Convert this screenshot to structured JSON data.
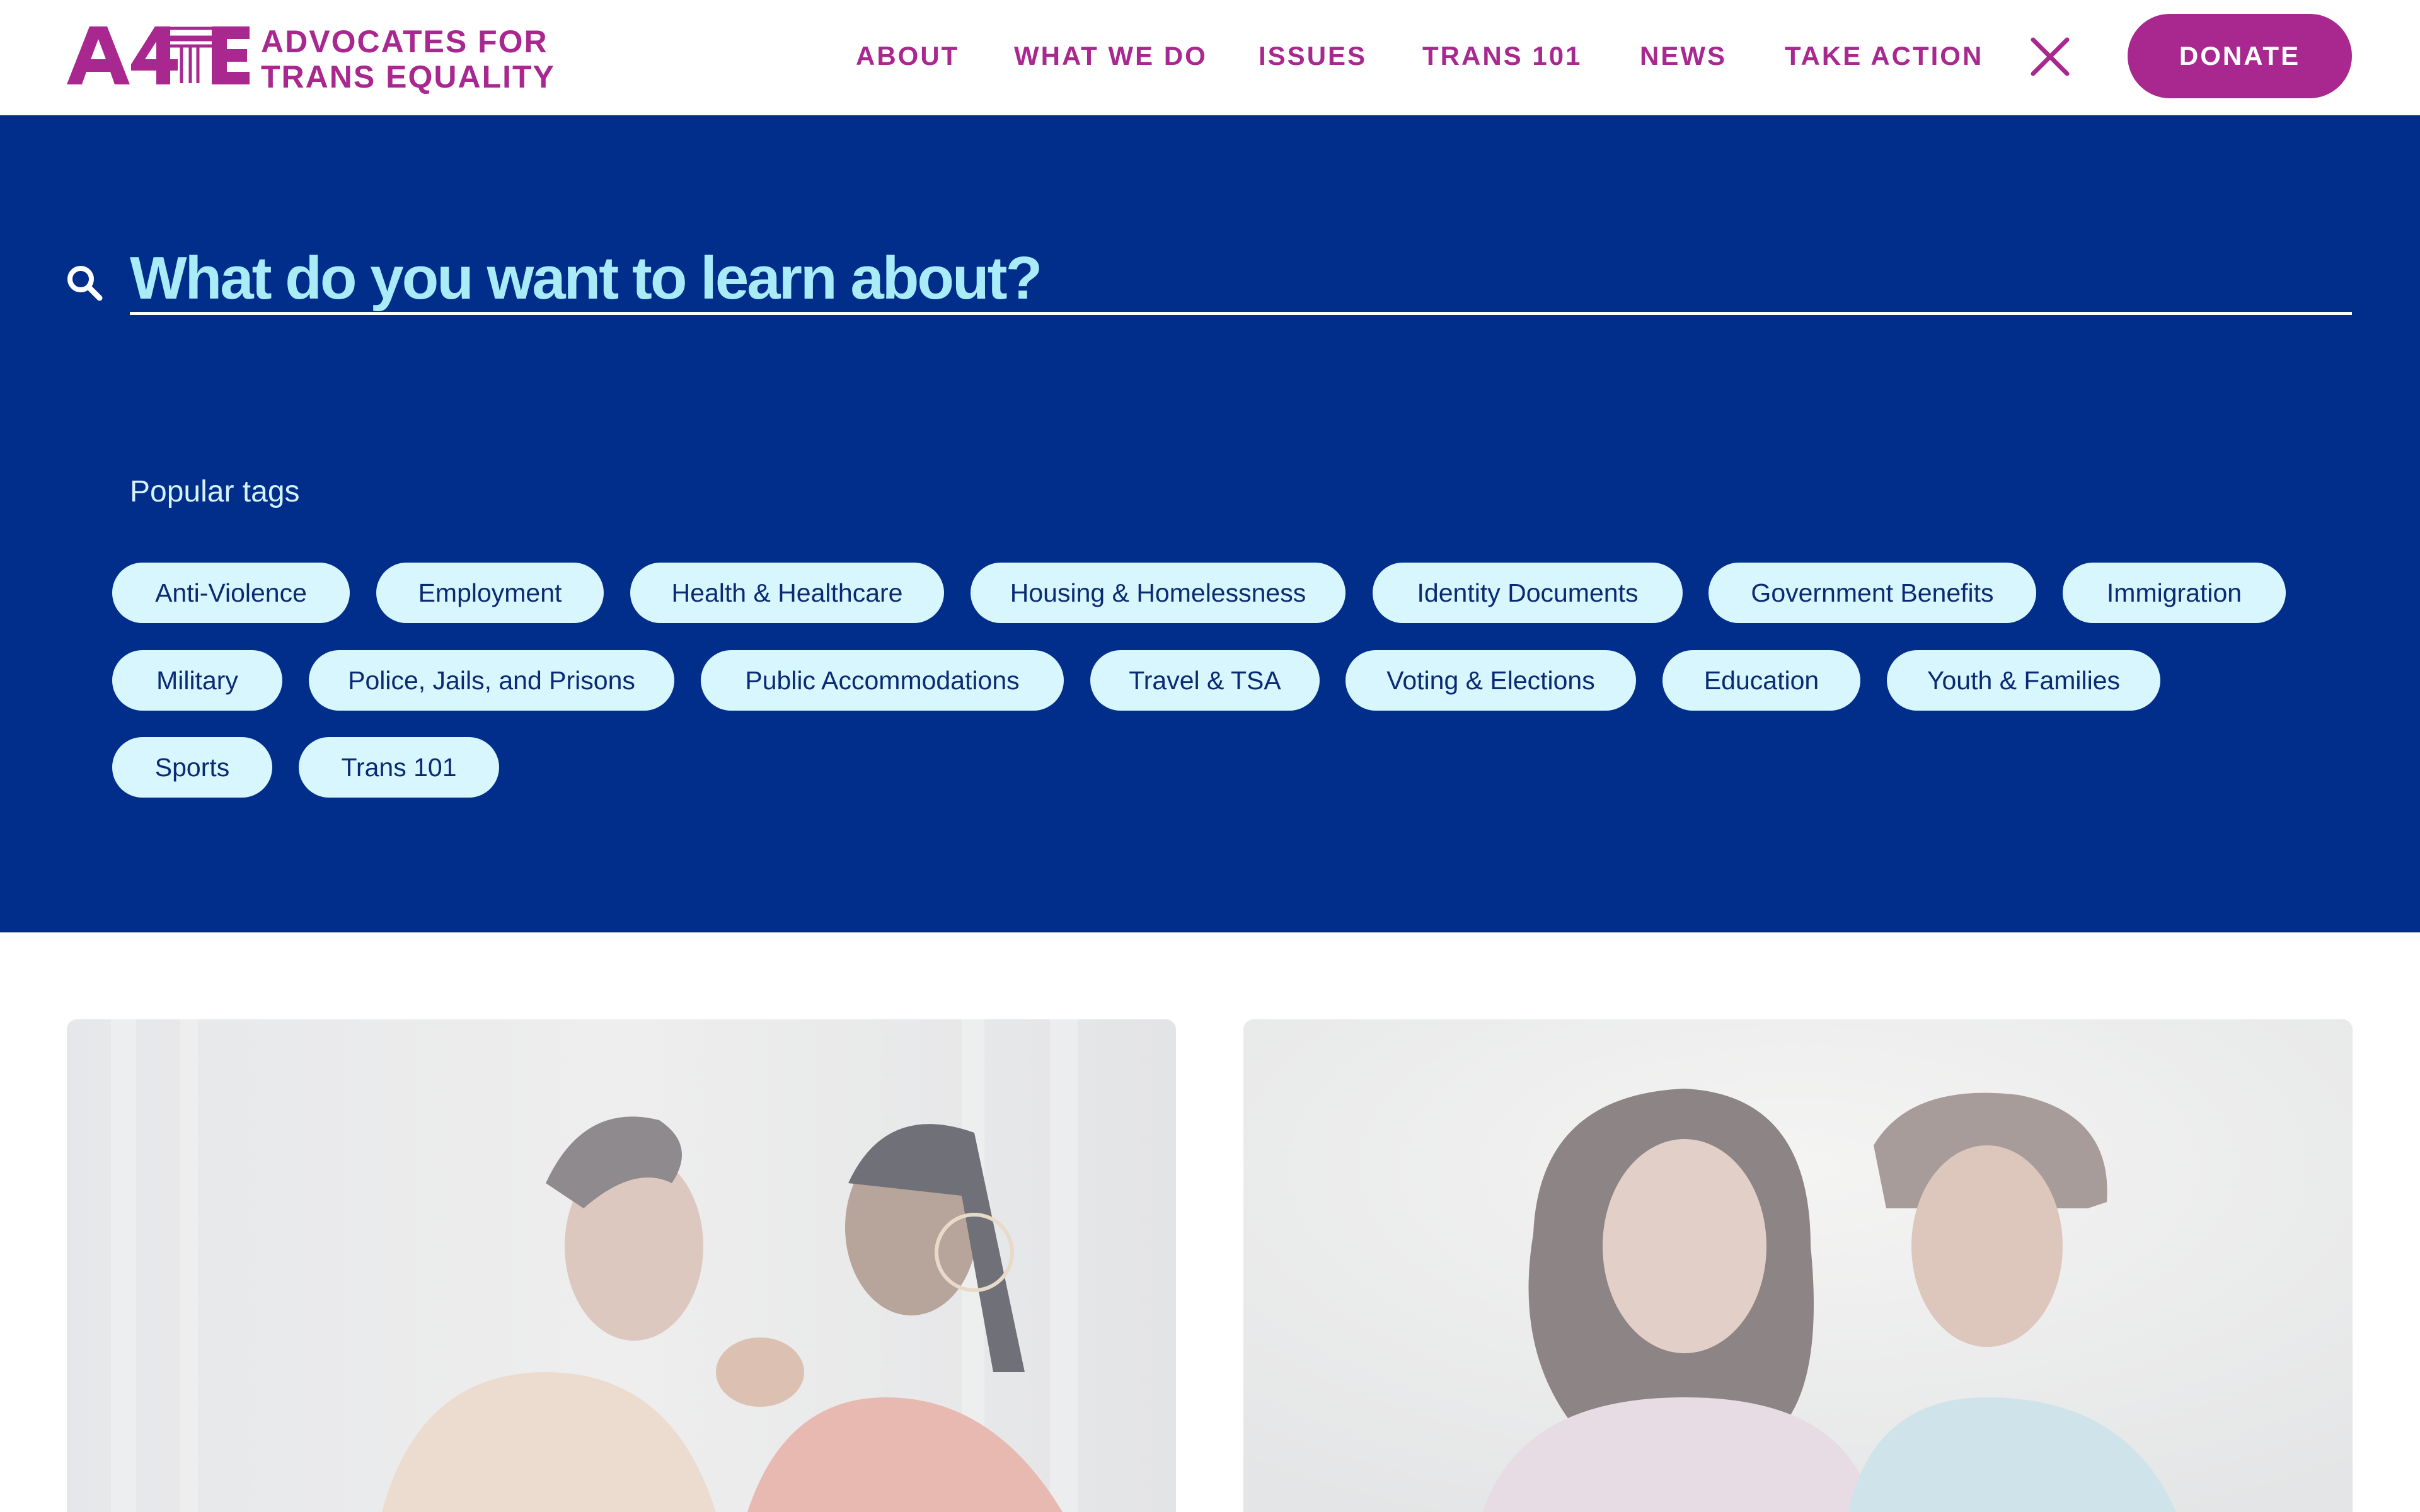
{
  "header": {
    "logo": {
      "mark": "A4TE",
      "line1": "ADVOCATES FOR",
      "line2": "TRANS EQUALITY"
    },
    "nav": [
      "ABOUT",
      "WHAT WE DO",
      "ISSUES",
      "TRANS 101",
      "NEWS",
      "TAKE ACTION"
    ],
    "close_icon": "close-icon",
    "donate_label": "DONATE"
  },
  "search": {
    "placeholder": "What do you want to learn about?",
    "icon": "search-icon"
  },
  "popular_tags": {
    "heading": "Popular tags",
    "tags": [
      "Anti-Violence",
      "Employment",
      "Health & Healthcare",
      "Housing & Homelessness",
      "Identity Documents",
      "Government Benefits",
      "Immigration",
      "Military",
      "Police, Jails, and Prisons",
      "Public Accommodations",
      "Travel & TSA",
      "Voting & Elections",
      "Education",
      "Youth & Families",
      "Sports",
      "Trans 101"
    ]
  },
  "colors": {
    "brand": "#a8288f",
    "panel_bg": "#002e8a",
    "search_text": "#a9ecf7",
    "tag_bg": "#d8f6fd",
    "tag_text": "#0a2a73"
  }
}
